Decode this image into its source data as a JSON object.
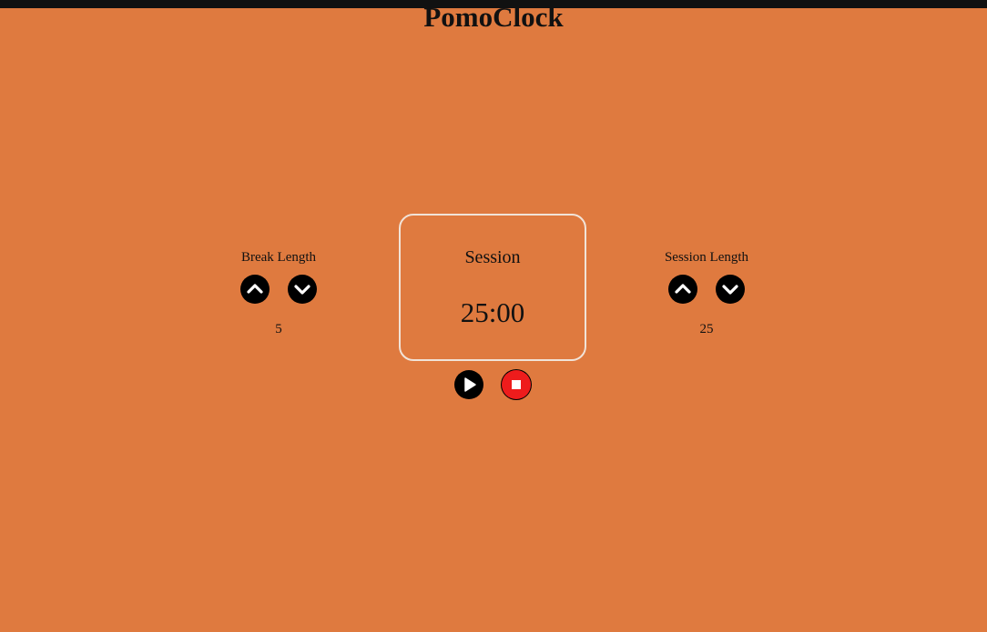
{
  "app": {
    "title": "PomoClock"
  },
  "break_control": {
    "label": "Break Length",
    "value": "5",
    "up_icon": "chevron-up-icon",
    "down_icon": "chevron-down-icon"
  },
  "session_control": {
    "label": "Session Length",
    "value": "25",
    "up_icon": "chevron-up-icon",
    "down_icon": "chevron-down-icon"
  },
  "timer": {
    "label": "Session",
    "time": "25:00"
  },
  "controls": {
    "play_icon": "play-icon",
    "stop_icon": "stop-icon"
  },
  "colors": {
    "background": "#df7a3f",
    "button": "#000000",
    "stop_button": "#ee1c1c",
    "timer_border": "#f1e3d8"
  }
}
